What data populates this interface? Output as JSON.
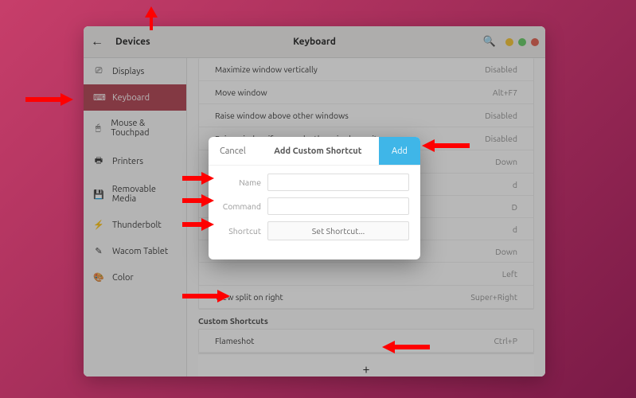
{
  "titlebar": {
    "devices_label": "Devices",
    "title": "Keyboard"
  },
  "sidebar": {
    "items": [
      {
        "icon": "⎚",
        "label": "Displays"
      },
      {
        "icon": "⌨",
        "label": "Keyboard"
      },
      {
        "icon": "🖱",
        "label": "Mouse & Touchpad"
      },
      {
        "icon": "🖶",
        "label": "Printers"
      },
      {
        "icon": "💾",
        "label": "Removable Media"
      },
      {
        "icon": "⚡",
        "label": "Thunderbolt"
      },
      {
        "icon": "✎",
        "label": "Wacom Tablet"
      },
      {
        "icon": "🎨",
        "label": "Color"
      }
    ]
  },
  "shortcuts": {
    "rows": [
      {
        "label": "Maximize window vertically",
        "value": "Disabled"
      },
      {
        "label": "Move window",
        "value": "Alt+F7"
      },
      {
        "label": "Raise window above other windows",
        "value": "Disabled"
      },
      {
        "label": "Raise window if covered, otherwise lower it",
        "value": "Disabled"
      }
    ],
    "split_right": {
      "label": "View split on right",
      "value": "Super+Right"
    },
    "custom_hdr": "Custom Shortcuts",
    "flameshot": {
      "label": "Flameshot",
      "value": "Ctrl+P"
    },
    "plus": "+",
    "peek_down": "Down",
    "peek_left": "Left"
  },
  "dialog": {
    "cancel": "Cancel",
    "title": "Add Custom Shortcut",
    "add": "Add",
    "name_lbl": "Name",
    "command_lbl": "Command",
    "shortcut_lbl": "Shortcut",
    "set_shortcut": "Set Shortcut..."
  }
}
